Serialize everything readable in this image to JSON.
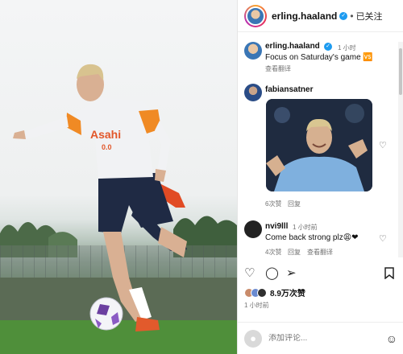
{
  "header": {
    "username": "erling.haaland",
    "follow_label": "已关注"
  },
  "post": {
    "author": "erling.haaland",
    "time": "1 小时",
    "caption": "Focus on Saturday's game 🆚",
    "translate": "查看翻译"
  },
  "comments": [
    {
      "username": "fabiansatner",
      "meta_likes": "6次赞",
      "reply": "回复"
    },
    {
      "username": "nvi9lll",
      "time": "1 小时前",
      "text": "Come back strong plz😩❤",
      "meta_likes": "4次赞",
      "reply": "回复",
      "translate": "查看翻译"
    }
  ],
  "actions": {
    "likes": "8.9万次赞",
    "posted": "1 小时前"
  },
  "add_comment": {
    "placeholder": "添加评论..."
  },
  "icons": [
    "verified-badge",
    "heart-icon",
    "comment-icon",
    "share-icon",
    "bookmark-icon",
    "emoji-icon"
  ],
  "colors": {
    "verified": "#1d9bf0",
    "kit": "#f08a24"
  }
}
